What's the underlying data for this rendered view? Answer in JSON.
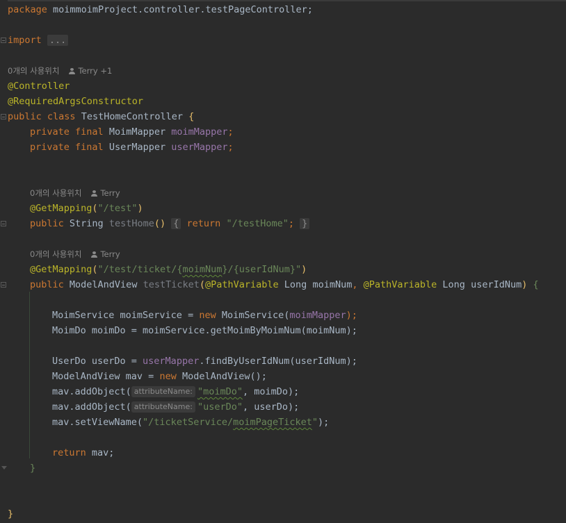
{
  "code": {
    "package_line": [
      "package",
      " moimmoimProject.controller.testPageController;"
    ],
    "import_kw": "import",
    "import_folded": "...",
    "usage_hint_class": {
      "count": "0개의 사용위치",
      "user": "Terry +1"
    },
    "annotation_controller": "@Controller",
    "annotation_rac": "@RequiredArgsConstructor",
    "class_decl": {
      "public": "public",
      "class": "class",
      "name": " TestHomeController ",
      "brace": "{"
    },
    "field1": {
      "private": "private",
      "final": "final",
      "type": " MoimMapper ",
      "name": "moimMapper",
      "semi": ";"
    },
    "field2": {
      "private": "private",
      "final": "final",
      "type": " UserMapper ",
      "name": "userMapper",
      "semi": ";"
    },
    "usage_hint_m1": {
      "count": "0개의 사용위치",
      "user": "Terry"
    },
    "m1_annotation": {
      "name": "@GetMapping",
      "arg": "\"/test\""
    },
    "m1_sig": {
      "public": "public",
      "ret": " String ",
      "name": "testHome",
      "parens": "()",
      "obrace": "{",
      "return": "return",
      "str": "\"/testHome\"",
      "semi": ";",
      "cbrace": "}"
    },
    "usage_hint_m2": {
      "count": "0개의 사용위치",
      "user": "Terry"
    },
    "m2_annotation": {
      "name": "@GetMapping",
      "p1": "\"/test/ticket/{",
      "v1": "moimNum",
      "p2": "}/{userIdNum}\""
    },
    "m2_sig": {
      "public": "public",
      "ret": " ModelAndView ",
      "name": "testTicket",
      "pv1": "@PathVariable",
      "t1": " Long ",
      "a1": "moimNum",
      "comma": ", ",
      "pv2": "@PathVariable",
      "t2": " Long ",
      "a2": "userIdNum",
      "obrace": "{"
    },
    "body": {
      "l1": {
        "type": "MoimService moimService = ",
        "new": "new",
        "cls": " MoimService(",
        "arg": "moimMapper",
        "end": ");"
      },
      "l2": {
        "text": "MoimDo moimDo = moimService.getMoimByMoimNum(moimNum);"
      },
      "l3": {
        "pre": "UserDo userDo = ",
        "fld": "userMapper",
        "post": ".findByUserIdNum(userIdNum);"
      },
      "l4": {
        "pre": "ModelAndView mav = ",
        "new": "new",
        "post": " ModelAndView();"
      },
      "l5": {
        "pre": "mav.addObject(",
        "hint": "attributeName:",
        "str": "\"moimDo\"",
        "post": ", moimDo);"
      },
      "l6": {
        "pre": "mav.addObject(",
        "hint": "attributeName:",
        "str": "\"userDo\"",
        "post": ", userDo);"
      },
      "l7": {
        "pre": "mav.setViewName(",
        "s1": "\"/ticketService/",
        "s2": "moimPageTicket",
        "s3": "\"",
        "post": ");"
      },
      "l8": {
        "return": "return",
        "post": " mav;"
      }
    },
    "m2_close": "}",
    "class_close": "}"
  },
  "colors": {
    "background": "#2b2b2b",
    "keyword": "#cc7832",
    "annotation": "#bbb529",
    "string": "#6a8759",
    "field": "#9876aa",
    "text": "#a9b7c6"
  }
}
